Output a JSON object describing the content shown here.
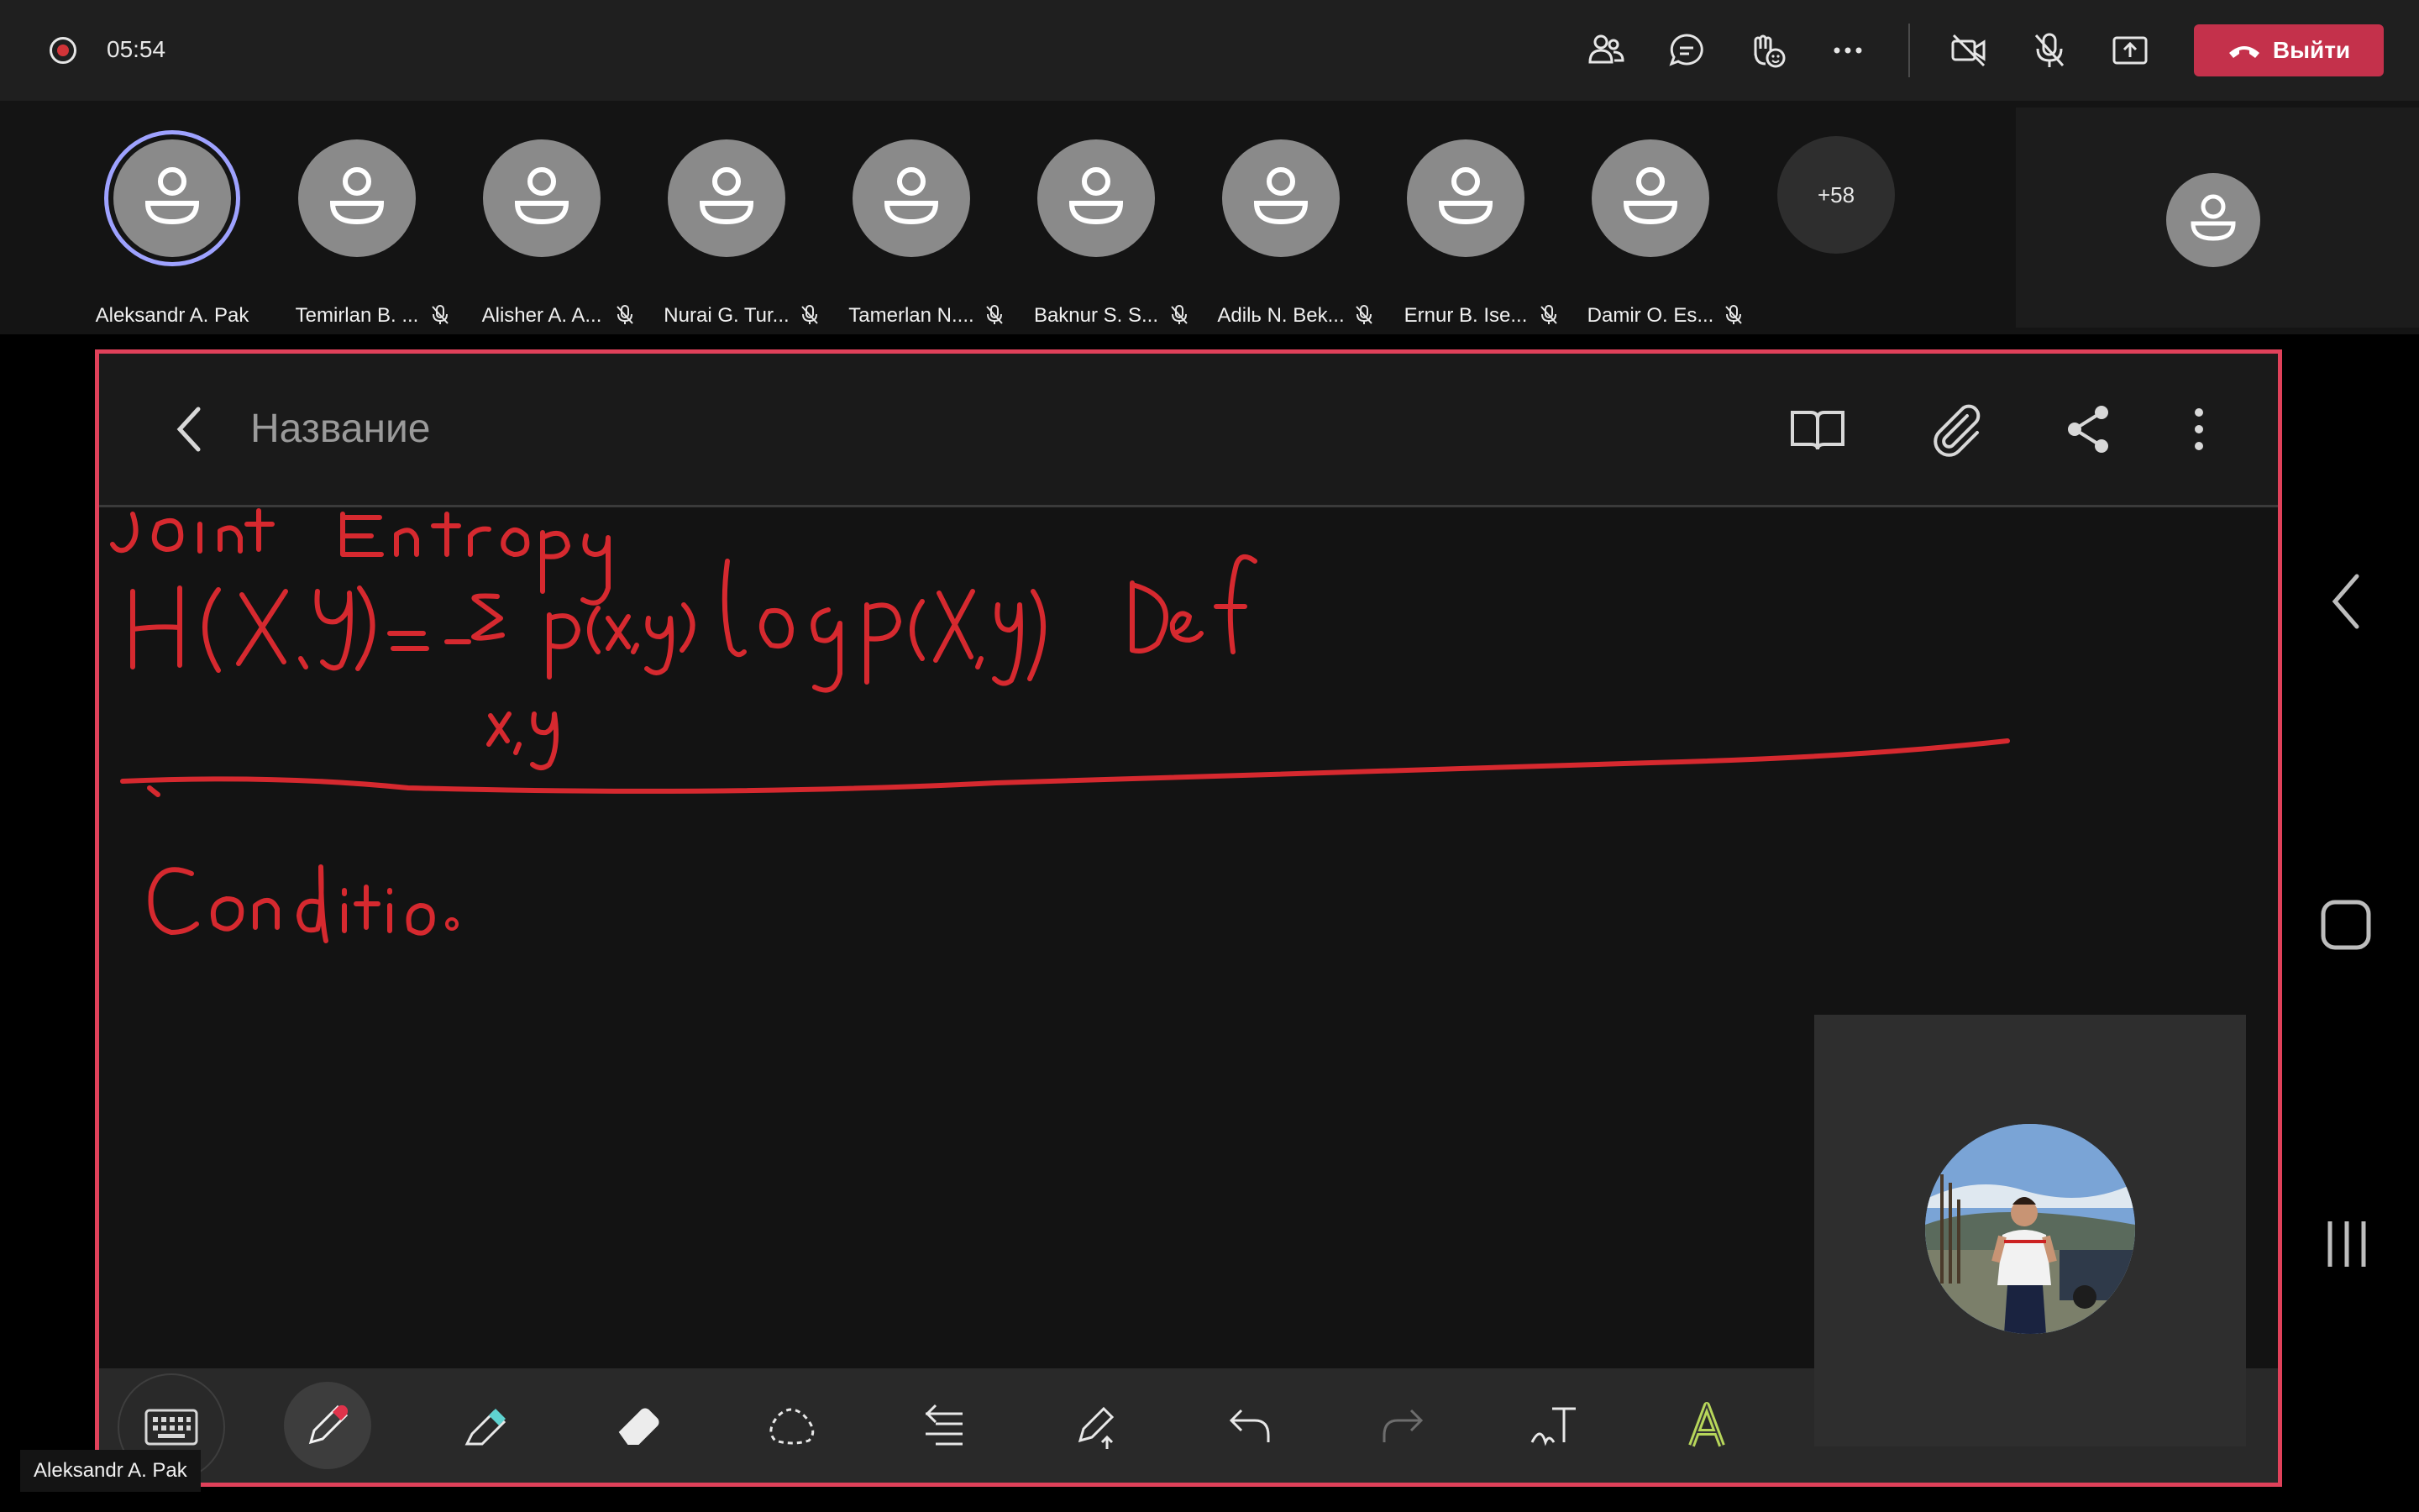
{
  "meeting": {
    "timer": "05:54",
    "leave_label": "Выйти",
    "colors": {
      "accent": "#c4314b",
      "recording": "#d13438",
      "active_ring": "#9ea2ff",
      "ink": "#d6292f"
    }
  },
  "participants": [
    {
      "name": "Aleksandr A. Pak",
      "active": true,
      "muted": false
    },
    {
      "name": "Temirlan B. ...",
      "active": false,
      "muted": true
    },
    {
      "name": "Alisher A. A...",
      "active": false,
      "muted": true
    },
    {
      "name": "Nurai G. Tur...",
      "active": false,
      "muted": true
    },
    {
      "name": "Tamerlan N....",
      "active": false,
      "muted": true
    },
    {
      "name": "Baknur S. S...",
      "active": false,
      "muted": true
    },
    {
      "name": "Adilь N. Bek...",
      "active": false,
      "muted": true
    },
    {
      "name": "Ernur B. Ise...",
      "active": false,
      "muted": true
    },
    {
      "name": "Damir O. Es...",
      "active": false,
      "muted": true
    }
  ],
  "overflow_count": "+58",
  "shared_screen": {
    "note_title": "Название",
    "presenter_tag": "Aleksandr A. Pak"
  },
  "icons": {
    "top_bar": [
      "people-icon",
      "chat-icon",
      "react-icon",
      "more-icon",
      "camera-off-icon",
      "mic-off-icon",
      "share-screen-icon"
    ],
    "note_header": [
      "back-icon",
      "book-icon",
      "attach-icon",
      "share-icon",
      "kebab-icon"
    ],
    "note_toolbar": [
      "keyboard-icon",
      "pen-icon",
      "highlighter-icon",
      "eraser-icon",
      "lasso-icon",
      "align-icon",
      "pen-settings-icon",
      "undo-icon",
      "redo-icon",
      "text-icon",
      "font-color-icon"
    ],
    "android_nav": [
      "nav-back-icon",
      "nav-home-icon",
      "nav-recents-icon"
    ]
  }
}
